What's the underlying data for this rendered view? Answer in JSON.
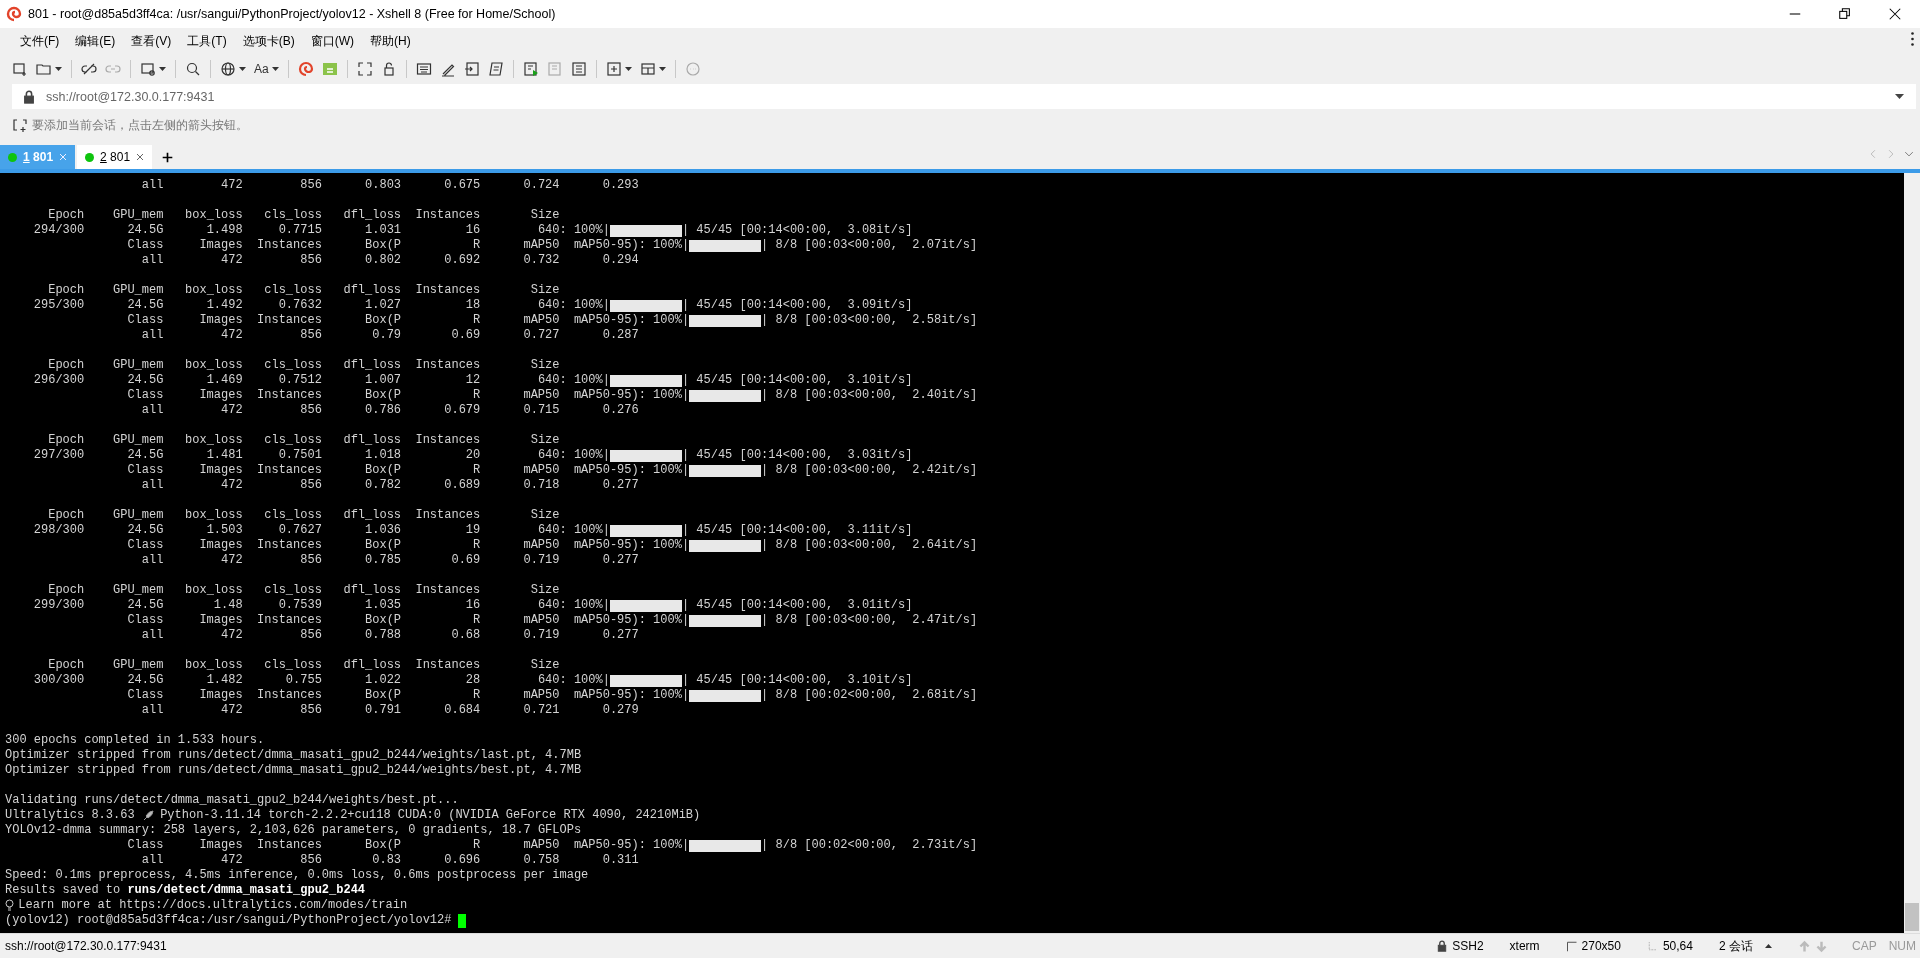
{
  "window": {
    "title": "801 - root@d85a5d3ff4ca: /usr/sangui/PythonProject/yolov12 - Xshell 8 (Free for Home/School)"
  },
  "menu": [
    "文件(F)",
    "编辑(E)",
    "查看(V)",
    "工具(T)",
    "选项卡(B)",
    "窗口(W)",
    "帮助(H)"
  ],
  "toolbar": {
    "font_button": "Aa"
  },
  "address": {
    "value": "ssh://root@172.30.0.177:9431"
  },
  "hint": "要添加当前会话，点击左侧的箭头按钮。",
  "tabs": [
    {
      "key": "1",
      "label": "801",
      "selected": true
    },
    {
      "key": "2",
      "label": "801",
      "selected": false
    }
  ],
  "terminal": {
    "blocks": [
      {
        "lines": [
          {
            "kind": "text",
            "text": "                   all        472        856      0.803      0.675      0.724      0.293"
          }
        ]
      },
      {
        "lines": [
          {
            "kind": "text",
            "text": "      Epoch    GPU_mem   box_loss   cls_loss   dfl_loss  Instances       Size"
          },
          {
            "kind": "progress",
            "text": "    294/300      24.5G      1.498     0.7715      1.031         16        640: 100%|",
            "after": "| 45/45 [00:14<00:00,  3.08it/s]"
          },
          {
            "kind": "progress",
            "text": "                 Class     Images  Instances      Box(P          R      mAP50  mAP50-95): 100%|",
            "after": "| 8/8 [00:03<00:00,  2.07it/s]"
          },
          {
            "kind": "text",
            "text": "                   all        472        856      0.802      0.692      0.732      0.294"
          }
        ]
      },
      {
        "lines": [
          {
            "kind": "text",
            "text": "      Epoch    GPU_mem   box_loss   cls_loss   dfl_loss  Instances       Size"
          },
          {
            "kind": "progress",
            "text": "    295/300      24.5G      1.492     0.7632      1.027         18        640: 100%|",
            "after": "| 45/45 [00:14<00:00,  3.09it/s]"
          },
          {
            "kind": "progress",
            "text": "                 Class     Images  Instances      Box(P          R      mAP50  mAP50-95): 100%|",
            "after": "| 8/8 [00:03<00:00,  2.58it/s]"
          },
          {
            "kind": "text",
            "text": "                   all        472        856       0.79       0.69      0.727      0.287"
          }
        ]
      },
      {
        "lines": [
          {
            "kind": "text",
            "text": "      Epoch    GPU_mem   box_loss   cls_loss   dfl_loss  Instances       Size"
          },
          {
            "kind": "progress",
            "text": "    296/300      24.5G      1.469     0.7512      1.007         12        640: 100%|",
            "after": "| 45/45 [00:14<00:00,  3.10it/s]"
          },
          {
            "kind": "progress",
            "text": "                 Class     Images  Instances      Box(P          R      mAP50  mAP50-95): 100%|",
            "after": "| 8/8 [00:03<00:00,  2.40it/s]"
          },
          {
            "kind": "text",
            "text": "                   all        472        856      0.786      0.679      0.715      0.276"
          }
        ]
      },
      {
        "lines": [
          {
            "kind": "text",
            "text": "      Epoch    GPU_mem   box_loss   cls_loss   dfl_loss  Instances       Size"
          },
          {
            "kind": "progress",
            "text": "    297/300      24.5G      1.481     0.7501      1.018         20        640: 100%|",
            "after": "| 45/45 [00:14<00:00,  3.03it/s]"
          },
          {
            "kind": "progress",
            "text": "                 Class     Images  Instances      Box(P          R      mAP50  mAP50-95): 100%|",
            "after": "| 8/8 [00:03<00:00,  2.42it/s]"
          },
          {
            "kind": "text",
            "text": "                   all        472        856      0.782      0.689      0.718      0.277"
          }
        ]
      },
      {
        "lines": [
          {
            "kind": "text",
            "text": "      Epoch    GPU_mem   box_loss   cls_loss   dfl_loss  Instances       Size"
          },
          {
            "kind": "progress",
            "text": "    298/300      24.5G      1.503     0.7627      1.036         19        640: 100%|",
            "after": "| 45/45 [00:14<00:00,  3.11it/s]"
          },
          {
            "kind": "progress",
            "text": "                 Class     Images  Instances      Box(P          R      mAP50  mAP50-95): 100%|",
            "after": "| 8/8 [00:03<00:00,  2.64it/s]"
          },
          {
            "kind": "text",
            "text": "                   all        472        856      0.785       0.69      0.719      0.277"
          }
        ]
      },
      {
        "lines": [
          {
            "kind": "text",
            "text": "      Epoch    GPU_mem   box_loss   cls_loss   dfl_loss  Instances       Size"
          },
          {
            "kind": "progress",
            "text": "    299/300      24.5G       1.48     0.7539      1.035         16        640: 100%|",
            "after": "| 45/45 [00:14<00:00,  3.01it/s]"
          },
          {
            "kind": "progress",
            "text": "                 Class     Images  Instances      Box(P          R      mAP50  mAP50-95): 100%|",
            "after": "| 8/8 [00:03<00:00,  2.47it/s]"
          },
          {
            "kind": "text",
            "text": "                   all        472        856      0.788       0.68      0.719      0.277"
          }
        ]
      },
      {
        "lines": [
          {
            "kind": "text",
            "text": "      Epoch    GPU_mem   box_loss   cls_loss   dfl_loss  Instances       Size"
          },
          {
            "kind": "progress",
            "text": "    300/300      24.5G      1.482      0.755      1.022         28        640: 100%|",
            "after": "| 45/45 [00:14<00:00,  3.10it/s]"
          },
          {
            "kind": "progress",
            "text": "                 Class     Images  Instances      Box(P          R      mAP50  mAP50-95): 100%|",
            "after": "| 8/8 [00:02<00:00,  2.68it/s]"
          },
          {
            "kind": "text",
            "text": "                   all        472        856      0.791      0.684      0.721      0.279"
          }
        ]
      },
      {
        "lines": [
          {
            "kind": "text",
            "text": "300 epochs completed in 1.533 hours."
          },
          {
            "kind": "text",
            "text": "Optimizer stripped from runs/detect/dmma_masati_gpu2_b244/weights/last.pt, 4.7MB"
          },
          {
            "kind": "text",
            "text": "Optimizer stripped from runs/detect/dmma_masati_gpu2_b244/weights/best.pt, 4.7MB"
          }
        ]
      },
      {
        "lines": [
          {
            "kind": "text",
            "text": "Validating runs/detect/dmma_masati_gpu2_b244/weights/best.pt..."
          },
          {
            "kind": "rocket",
            "text": "Ultralytics 8.3.63",
            "after": "Python-3.11.14 torch-2.2.2+cu118 CUDA:0 (NVIDIA GeForce RTX 4090, 24210MiB)"
          },
          {
            "kind": "text",
            "text": "YOLOv12-dmma summary: 258 layers, 2,103,626 parameters, 0 gradients, 18.7 GFLOPs"
          },
          {
            "kind": "progress",
            "text": "                 Class     Images  Instances      Box(P          R      mAP50  mAP50-95): 100%|",
            "after": "| 8/8 [00:02<00:00,  2.73it/s]"
          },
          {
            "kind": "text",
            "text": "                   all        472        856       0.83      0.696      0.758      0.311"
          },
          {
            "kind": "text",
            "text": "Speed: 0.1ms preprocess, 4.5ms inference, 0.0ms loss, 0.6ms postprocess per image"
          },
          {
            "kind": "text",
            "text": "Results saved to **runs/detect/dmma_masati_gpu2_b244**"
          },
          {
            "kind": "bulb",
            "after": "Learn more at https://docs.ultralytics.com/modes/train"
          },
          {
            "kind": "prompt",
            "text": "(yolov12) root@d85a5d3ff4ca:/usr/sangui/PythonProject/yolov12#"
          }
        ]
      }
    ]
  },
  "status_bar": {
    "address": "ssh://root@172.30.0.177:9431",
    "protocol": "SSH2",
    "terminal_type": "xterm",
    "size": "270x50",
    "cursor": "50,64",
    "sessions": "2 会话",
    "keys": [
      {
        "label": "CAP",
        "on": false
      },
      {
        "label": "NUM",
        "on": false
      }
    ]
  }
}
